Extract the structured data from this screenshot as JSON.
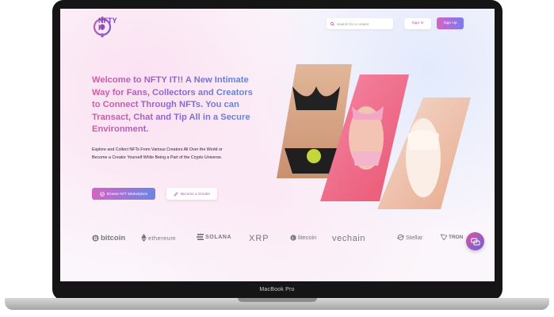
{
  "device": {
    "label": "MacBook Pro"
  },
  "header": {
    "logo_text": "NFTY IT",
    "search_placeholder": "Search for a creator",
    "signin_label": "Sign In",
    "signup_label": "Sign Up"
  },
  "hero": {
    "headline": "Welcome to NFTY IT!! A New Intimate Way for Fans, Collectors and Creators to Connect Through NFTs. You can Transact, Chat and Tip All in a Secure Environment.",
    "paragraph": "Explore and Collect NFTs From Various Creators All Over the World or Become a Creator Yourself While Being a Part of the Crypto Universe.",
    "primary_button": "Browse NFT Marketplace",
    "secondary_button": "Become a Creator"
  },
  "crypto_logos": [
    "bitcoin",
    "ethereum",
    "SOLANA",
    "XRP",
    "litecoin",
    "vechain",
    "Stellar",
    "TRON"
  ],
  "icons": [
    "search-icon",
    "wallet-icon",
    "pencil-icon",
    "chat-icon"
  ],
  "colors": {
    "accent_pink": "#d464c4",
    "accent_blue": "#7a7cf0",
    "laptop_frame": "#151515"
  }
}
